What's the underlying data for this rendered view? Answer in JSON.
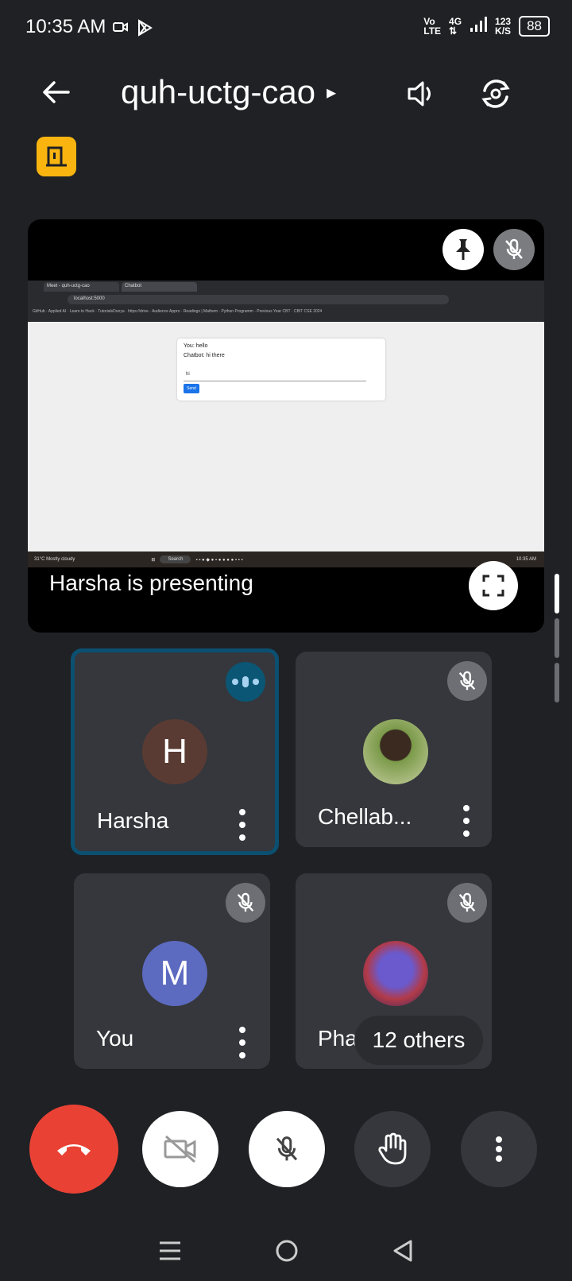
{
  "status_bar": {
    "time": "10:35 AM",
    "network_top": "Vo",
    "network_bottom": "LTE",
    "gen": "4G",
    "speed_top": "123",
    "speed_bottom": "K/S",
    "battery": "88"
  },
  "header": {
    "meeting_code": "quh-uctg-cao",
    "caret": "▸"
  },
  "presentation": {
    "label": "Harsha is presenting",
    "screen": {
      "tab1": "Meet - quh-uctg-cao",
      "tab2": "Chatbot",
      "url": "localhost:5000",
      "bookmarks": "GitHub · Applied AI · Learn to Hack · TutorialsDunya · https://drive · Audience Appro · Readings | Mathem · Python Programm · Previous Year CBT · CBIT CSE 2024",
      "chat_line1": "You: hello",
      "chat_line2": "Chatbot: hi there",
      "chat_input": "hi",
      "send_label": "Send",
      "search_label": "Search",
      "weather": "31°C Mostly cloudy",
      "clock": "10:35 AM"
    }
  },
  "participants": [
    {
      "name": "Harsha",
      "initial": "H",
      "color": "#5a3b33",
      "speaking": true
    },
    {
      "name": "Chellab...",
      "initial": "",
      "color": "#5c6e3a",
      "muted": true
    },
    {
      "name": "You",
      "initial": "M",
      "color": "#5c6bc0",
      "muted": true
    },
    {
      "name": "Phane",
      "initial": "",
      "color": "#3a2f6e",
      "muted": true
    }
  ],
  "others_label": "12 others",
  "colors": {
    "end_call": "#e94235",
    "active_border": "#0b4f71",
    "room_badge": "#f9b410"
  }
}
